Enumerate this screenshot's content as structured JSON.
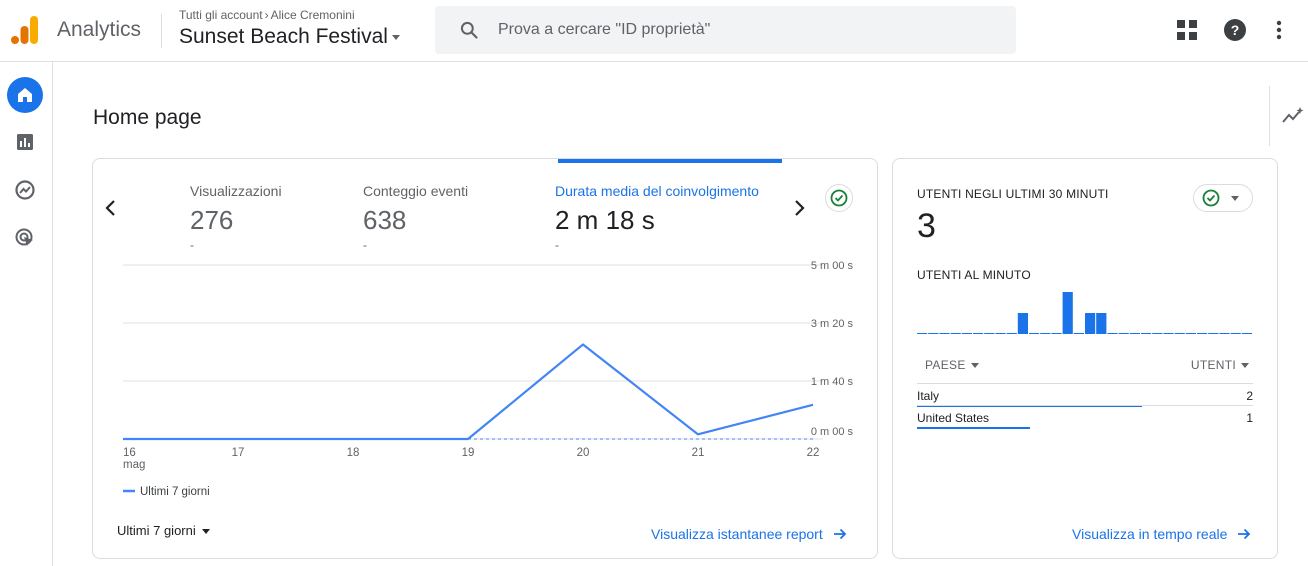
{
  "header": {
    "app_name": "Analytics",
    "breadcrumb_all": "Tutti gli account",
    "breadcrumb_account": "Alice Cremonini",
    "property_name": "Sunset Beach Festival",
    "search_placeholder": "Prova a cercare \"ID proprietà\"",
    "icons": [
      "apps-icon",
      "help-icon",
      "more-vert-icon"
    ]
  },
  "nav": {
    "items": [
      {
        "name": "home",
        "icon": "home-icon",
        "active": true
      },
      {
        "name": "reports",
        "icon": "bar-chart-icon",
        "active": false
      },
      {
        "name": "explore",
        "icon": "explore-icon",
        "active": false
      },
      {
        "name": "advertising",
        "icon": "advertising-icon",
        "active": false
      }
    ]
  },
  "page": {
    "title": "Home page"
  },
  "main_card": {
    "metrics": [
      {
        "label": "Visualizzazioni",
        "value": "276",
        "delta": "-"
      },
      {
        "label": "Conteggio eventi",
        "value": "638",
        "delta": "-"
      },
      {
        "label": "Durata media del coinvolgimento",
        "value": "2 m 18 s",
        "delta": "-",
        "active": true
      }
    ],
    "range_label": "Ultimi 7 giorni",
    "link": "Visualizza istantanee report"
  },
  "chart_data": {
    "type": "line",
    "x": [
      "16",
      "17",
      "18",
      "19",
      "20",
      "21",
      "22"
    ],
    "x_sublabel": "mag",
    "series": [
      {
        "name": "Ultimi 7 giorni",
        "values": [
          0,
          0,
          0,
          0,
          163,
          8,
          59
        ],
        "color": "#4285f4"
      }
    ],
    "yticks": [
      "0 m 00 s",
      "1 m 40 s",
      "3 m 20 s",
      "5 m 00 s"
    ],
    "ylim": [
      0,
      300
    ],
    "legend": "bottom-left",
    "grid": true
  },
  "realtime": {
    "title": "UTENTI NEGLI ULTIMI 30 MINUTI",
    "value": "3",
    "per_minute_title": "UTENTI AL MINUTO",
    "per_minute": [
      0,
      0,
      0,
      0,
      0,
      0,
      0,
      0,
      0,
      1,
      0,
      0,
      0,
      2,
      0,
      1,
      1,
      0,
      0,
      0,
      0,
      0,
      0,
      0,
      0,
      0,
      0,
      0,
      0,
      0
    ],
    "col_country": "PAESE",
    "col_users": "UTENTI",
    "rows": [
      {
        "country": "Italy",
        "users": "2",
        "share": 1.0
      },
      {
        "country": "United States",
        "users": "1",
        "share": 0.5
      }
    ],
    "link": "Visualizza in tempo reale"
  },
  "colors": {
    "accent": "#1a73e8",
    "line": "#4285f4",
    "success": "#188038"
  }
}
